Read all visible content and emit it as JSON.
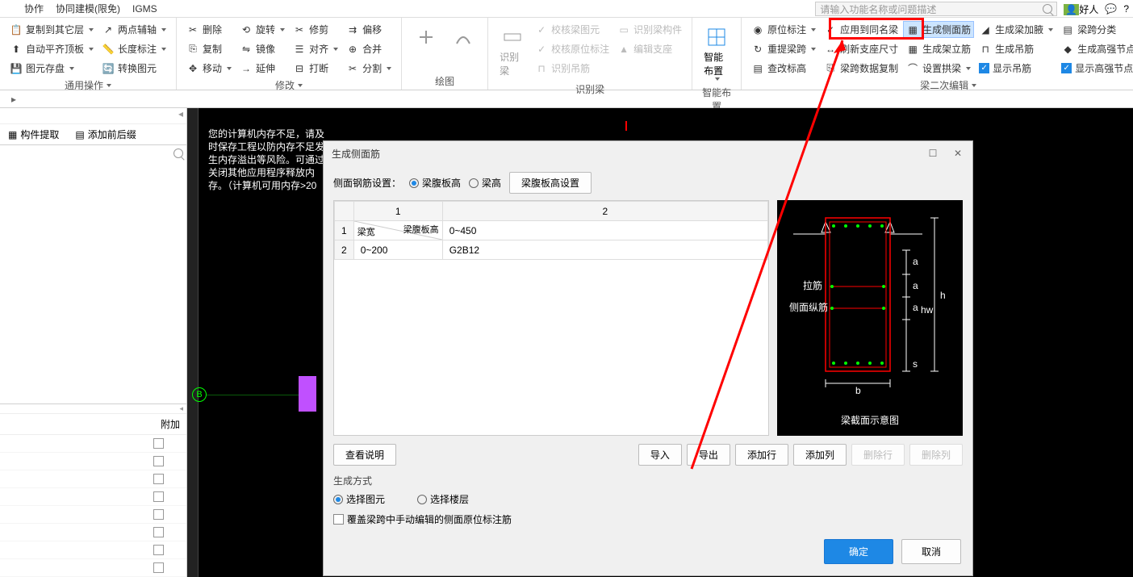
{
  "menu": {
    "items": [
      "协作",
      "协同建模(限免)",
      "IGMS"
    ]
  },
  "search": {
    "placeholder": "请输入功能名称或问题描述"
  },
  "user": {
    "name": "好人"
  },
  "ribbon": {
    "g1": {
      "btns": [
        "复制到其它层",
        "自动平齐顶板",
        "图元存盘",
        "两点辅轴",
        "长度标注",
        "转换图元"
      ],
      "label": "通用操作"
    },
    "g2": {
      "btns": [
        "删除",
        "复制",
        "移动",
        "旋转",
        "镜像",
        "延伸",
        "修剪",
        "对齐",
        "打断",
        "偏移",
        "合并",
        "分割"
      ],
      "label": "修改"
    },
    "g3": {
      "label": "绘图"
    },
    "g4": {
      "btn": "识别梁",
      "btns": [
        "校核梁图元",
        "校核原位标注",
        "识别吊筋",
        "识别梁构件",
        "编辑支座"
      ],
      "label": "识别梁"
    },
    "g5": {
      "btn": "智能布置",
      "label": "智能布置"
    },
    "g6": {
      "c1": [
        "原位标注",
        "重提梁跨",
        "查改标高"
      ],
      "c2": [
        "应用到同名梁",
        "刷新支座尺寸",
        "梁跨数据复制"
      ],
      "c3": [
        "生成侧面筋",
        "生成架立筋",
        "设置拱梁"
      ],
      "c4": [
        "生成梁加腋",
        "生成吊筋"
      ],
      "c4b": [
        "显示吊筋"
      ],
      "c5": [
        "梁跨分类",
        "生成高强节点"
      ],
      "c5b": [
        "显示高强节点"
      ],
      "label": "梁二次编辑"
    }
  },
  "leftPanel": {
    "tab1": "构件提取",
    "tab2": "添加前后缀",
    "attachLabel": "附加"
  },
  "canvas": {
    "warning": "您的计算机内存不足，请及时保存工程以防内存不足发生内存溢出等风险。可通过关闭其他应用程序释放内存。（计算机可用内存>20",
    "marker": "B"
  },
  "dialog": {
    "title": "生成侧面筋",
    "settingLabel": "侧面钢筋设置：",
    "radio1": "梁腹板高",
    "radio2": "梁高",
    "settingBtn": "梁腹板高设置",
    "table": {
      "colHeaders": [
        "1",
        "2"
      ],
      "diagTop": "梁腹板高",
      "diagBottom": "梁宽",
      "rows": [
        {
          "h": "1",
          "c1": "",
          "c2": "0~450"
        },
        {
          "h": "2",
          "c1": "0~200",
          "c2": "G2B12"
        }
      ]
    },
    "diagram": {
      "title": "梁截面示意图",
      "labelTie": "拉筋",
      "labelSide": "侧面纵筋",
      "a": "a",
      "hw": "hw",
      "h": "h",
      "s": "s",
      "b": "b"
    },
    "btns": {
      "viewDesc": "查看说明",
      "import": "导入",
      "export": "导出",
      "addRow": "添加行",
      "addCol": "添加列",
      "delRow": "删除行",
      "delCol": "删除列"
    },
    "genLabel": "生成方式",
    "genRadio1": "选择图元",
    "genRadio2": "选择楼层",
    "overwriteLabel": "覆盖梁跨中手动编辑的侧面原位标注筋",
    "ok": "确定",
    "cancel": "取消"
  }
}
